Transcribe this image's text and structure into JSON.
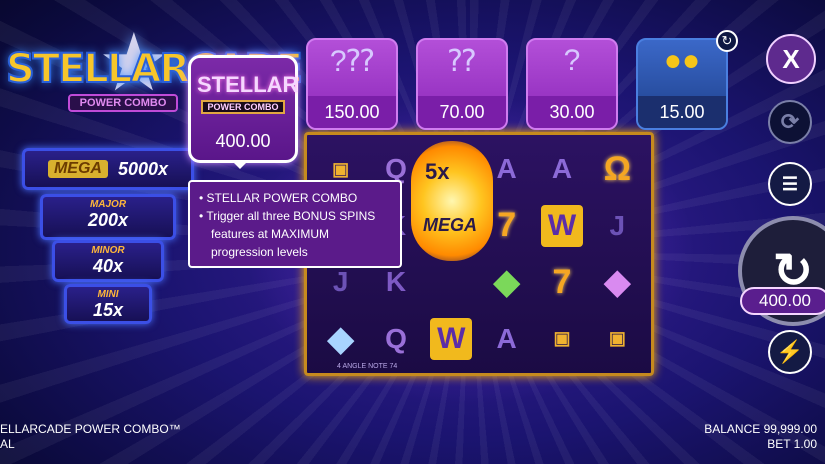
{
  "game": {
    "logo_text": "STELLARCADE",
    "logo_sub": "POWER COMBO",
    "title_line1": "ELLARCADE POWER COMBO™",
    "title_line2": "AL"
  },
  "jackpots": [
    {
      "label": "MEGA",
      "value": "5000x"
    },
    {
      "label": "MAJOR",
      "value": "200x"
    },
    {
      "label": "MINOR",
      "value": "40x"
    },
    {
      "label": "MINI",
      "value": "15x"
    }
  ],
  "bonus_tiles": [
    {
      "icon": "triple-bonus-orb-icon",
      "value": "150.00"
    },
    {
      "icon": "double-bonus-orb-icon",
      "value": "70.00"
    },
    {
      "icon": "single-bonus-orb-icon",
      "value": "30.00"
    },
    {
      "icon": "gold-coins-icon",
      "value": "15.00"
    }
  ],
  "selected_tile": {
    "word": "STELLAR",
    "sub": "POWER COMBO",
    "value": "400.00"
  },
  "tooltip": {
    "line1": "• STELLAR POWER COMBO",
    "line2": "• Trigger all three BONUS SPINS",
    "line3": "features at MAXIMUM",
    "line4": "progression levels"
  },
  "reels": {
    "mega_multiplier": "5x",
    "mega_label": "MEGA",
    "footer": "4 ANGLE NOTE 74"
  },
  "controls": {
    "close_label": "X",
    "bet_display": "400.00"
  },
  "footer": {
    "balance": "BALANCE 99,999.00",
    "bet": "BET 1.00"
  }
}
